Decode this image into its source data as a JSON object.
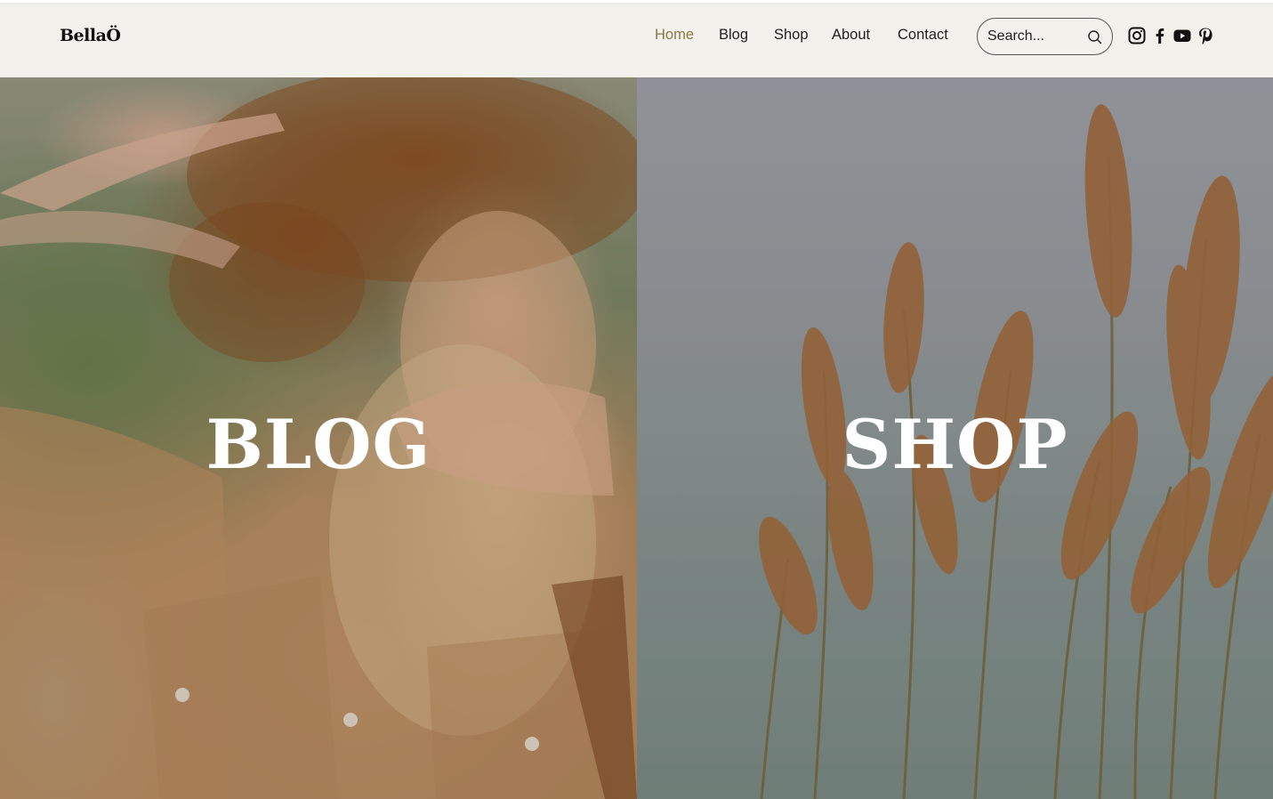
{
  "header": {
    "logo": "BellaÖ",
    "nav": [
      {
        "label": "Home",
        "active": true
      },
      {
        "label": "Blog",
        "active": false
      },
      {
        "label": "Shop",
        "active": false
      },
      {
        "label": "About",
        "active": false
      },
      {
        "label": "Contact",
        "active": false
      }
    ],
    "search": {
      "placeholder": "Search...",
      "value": "",
      "icon": "search-icon"
    },
    "social": [
      {
        "name": "instagram-icon"
      },
      {
        "name": "facebook-icon"
      },
      {
        "name": "youtube-icon"
      },
      {
        "name": "pinterest-icon"
      }
    ],
    "active_color": "#8a7a44"
  },
  "panels": [
    {
      "title": "BLOG",
      "image": "woman in straw hat"
    },
    {
      "title": "SHOP",
      "image": "pampas grass by water"
    }
  ]
}
